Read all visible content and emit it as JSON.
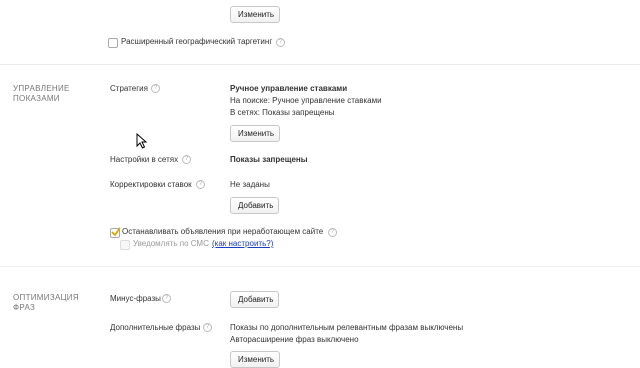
{
  "geo": {
    "change_button": "Изменить",
    "extended_geo_checkbox_label": "Расширенный географический таргетинг"
  },
  "impressions_section": {
    "title_line1": "Управление",
    "title_line2": "показами",
    "strategy_label": "Стратегия",
    "strategy_value": "Ручное управление ставками",
    "strategy_search": "На поиске: Ручное управление ставками",
    "strategy_networks": "В сетях: Показы запрещены",
    "strategy_change_button": "Изменить",
    "network_settings_label": "Настройки в сетях",
    "network_settings_value": "Показы запрещены",
    "bid_adjustments_label": "Корректировки ставок",
    "bid_adjustments_value": "Не заданы",
    "bid_adjustments_add_button": "Добавить",
    "stop_ads_label": "Останавливать объявления при неработающем сайте",
    "stop_ads_checked": true,
    "sms_notify_label": "Уведомлять по СМС",
    "sms_notify_link": "(как настроить?)"
  },
  "optimization_section": {
    "title_line1": "Оптимизация",
    "title_line2": "фраз",
    "minus_phrases_label": "Минус-фразы",
    "minus_phrases_add_button": "Добавить",
    "extra_phrases_label": "Дополнительные фразы",
    "extra_phrases_line1": "Показы по дополнительным релевантным фразам выключены",
    "extra_phrases_line2": "Авторасширение фраз выключено",
    "extra_phrases_change_button": "Изменить"
  },
  "hint_icon": "question-hint-icon",
  "cursor_icon": "mouse-pointer-icon",
  "colors": {
    "link": "#1a3dc1",
    "check": "#e0a400",
    "divider": "#ececec"
  }
}
